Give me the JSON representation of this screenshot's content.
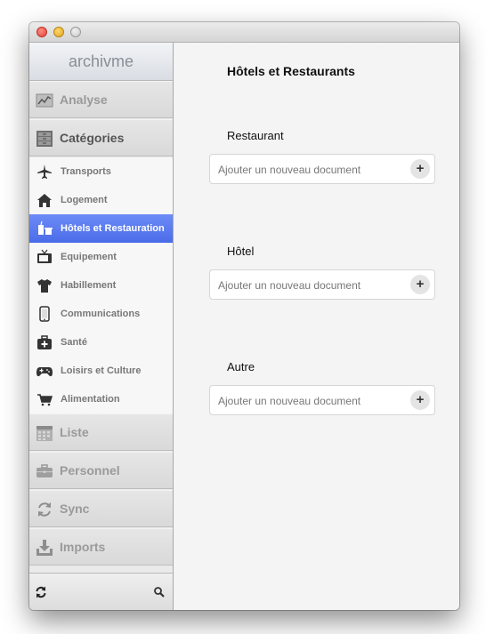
{
  "app": {
    "brand": "archivme"
  },
  "sidebar": {
    "sections": [
      {
        "label": "Analyse",
        "icon": "chart-icon"
      },
      {
        "label": "Catégories",
        "icon": "drawers-icon"
      },
      {
        "label": "Liste",
        "icon": "calendar-icon"
      },
      {
        "label": "Personnel",
        "icon": "briefcase-icon"
      },
      {
        "label": "Sync",
        "icon": "sync-icon"
      },
      {
        "label": "Imports",
        "icon": "import-icon"
      }
    ],
    "categories": [
      {
        "label": "Transports",
        "icon": "airplane-icon"
      },
      {
        "label": "Logement",
        "icon": "house-icon"
      },
      {
        "label": "Hôtels et Restauration",
        "icon": "drink-icon",
        "selected": true
      },
      {
        "label": "Equipement",
        "icon": "tv-icon"
      },
      {
        "label": "Habillement",
        "icon": "tshirt-icon"
      },
      {
        "label": "Communications",
        "icon": "phone-icon"
      },
      {
        "label": "Santé",
        "icon": "medkit-icon"
      },
      {
        "label": "Loisirs et Culture",
        "icon": "gamepad-icon"
      },
      {
        "label": "Alimentation",
        "icon": "cart-icon"
      }
    ],
    "bottom": {
      "refresh_icon": "refresh-icon",
      "search_icon": "search-icon"
    }
  },
  "main": {
    "title": "Hôtels et Restaurants",
    "groups": [
      {
        "label": "Restaurant",
        "placeholder": "Ajouter un nouveau document",
        "add": "+"
      },
      {
        "label": "Hôtel",
        "placeholder": "Ajouter un nouveau document",
        "add": "+"
      },
      {
        "label": "Autre",
        "placeholder": "Ajouter un nouveau document",
        "add": "+"
      }
    ]
  },
  "colors": {
    "selected": "#4a6ce8",
    "close": "#e0443a",
    "minimize": "#e0a625",
    "zoom": "#c8c8c8"
  }
}
